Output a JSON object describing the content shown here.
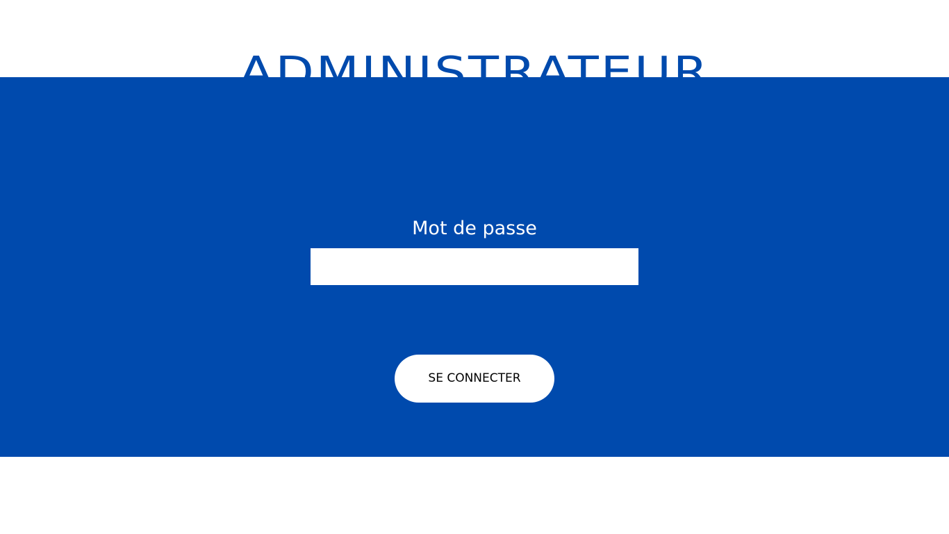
{
  "header": {
    "title": "ADMINISTRATEUR"
  },
  "login_form": {
    "password_label": "Mot de passe",
    "password_value": "",
    "connect_button_label": "SE CONNECTER"
  },
  "colors": {
    "brand_blue": "#004aad",
    "background": "#ffffff",
    "button_background": "#ffffff"
  }
}
